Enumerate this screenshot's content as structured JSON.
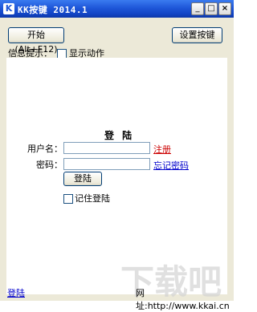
{
  "window": {
    "title": "KK按键 2014.1",
    "app_icon": "K",
    "minimize_glyph": "_",
    "maximize_glyph": "□",
    "close_glyph": "×"
  },
  "toolbar": {
    "start_label": "开始 (Alt+F12)",
    "hotkey_label": "设置按键"
  },
  "info": {
    "label": "信息提示：",
    "show_action_label": "显示动作"
  },
  "login": {
    "title": "登 陆",
    "username_label": "用户名：",
    "password_label": "密码：",
    "register_link": "注册",
    "forgot_link": "忘记密码",
    "login_button": "登陆",
    "remember_label": "记住登陆"
  },
  "footer": {
    "login_link": "登陆",
    "url": "网址:http://www.kkai.cn"
  },
  "watermark": "下载吧"
}
